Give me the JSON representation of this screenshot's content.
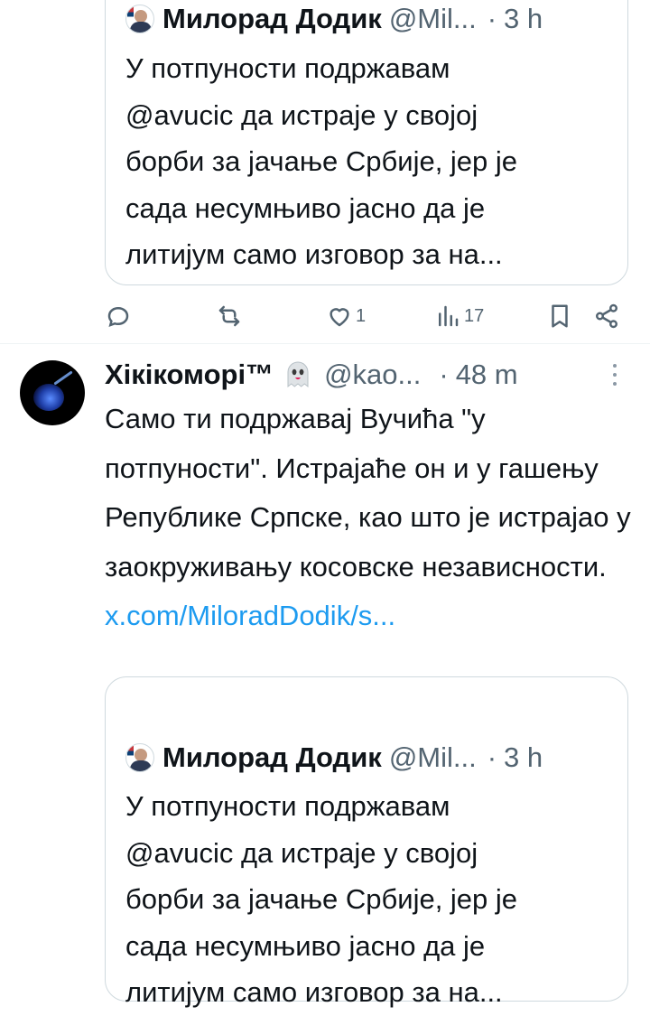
{
  "top_quote": {
    "name": "Милорад Додик",
    "handle": "@Mil...",
    "separator": "·",
    "time": "3 h",
    "text": "У потпуности подржавам\n@avucic да истраје у својој\nборби за јачање Србије, јер је\nсада несумњиво јасно да је\nлитијум само изговор за на..."
  },
  "actions": {
    "reply_count": "",
    "retweet_count": "",
    "like_count": "1",
    "views_count": "17"
  },
  "tweet": {
    "name": "Хікікоморі™",
    "handle": "@kao...",
    "separator": "·",
    "time": "48 m",
    "text": "Само ти подржавај Вучића \"у потпуности\". Истрајаће он и у гашењу Републике Српске, као што је истрајао у заокруживању косовске независности.",
    "link": "x.com/MiloradDodik/s..."
  },
  "bottom_quote": {
    "name": "Милорад Додик",
    "handle": "@Mil...",
    "separator": "·",
    "time": "3 h",
    "text": "У потпуности подржавам\n@avucic да истраје у својој\nборби за јачање Србије, јер је\nсада несумњиво јасно да је\nлитијум само изговор за на..."
  },
  "colors": {
    "text": "#0f1419",
    "secondary": "#536471",
    "link": "#1d9bf0",
    "border": "#cfd9de"
  }
}
